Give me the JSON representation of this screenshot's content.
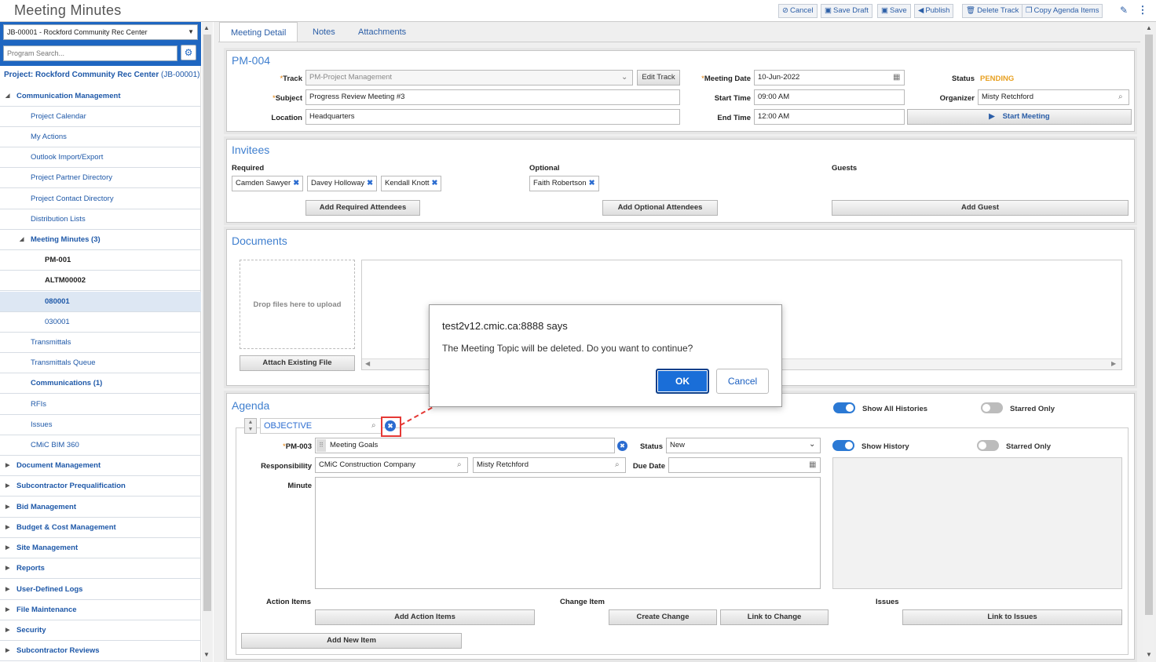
{
  "app": {
    "title": "Meeting Minutes"
  },
  "toolbar": {
    "cancel": "Cancel",
    "save_draft": "Save Draft",
    "save": "Save",
    "publish": "Publish",
    "delete_track": "Delete Track",
    "copy_agenda_items": "Copy Agenda Items"
  },
  "sidebar": {
    "project_select": "JB-00001 - Rockford Community Rec Center",
    "search_placeholder": "Program Search...",
    "project_label": "Project: Rockford Community Rec Center",
    "project_code": "(JB-00001)",
    "items": [
      {
        "label": "Communication Management"
      },
      {
        "label": "Project Calendar"
      },
      {
        "label": "My Actions"
      },
      {
        "label": "Outlook Import/Export"
      },
      {
        "label": "Project Partner Directory"
      },
      {
        "label": "Project Contact Directory"
      },
      {
        "label": "Distribution Lists"
      },
      {
        "label": "Meeting Minutes (3)"
      },
      {
        "label": "PM-001"
      },
      {
        "label": "ALTM00002"
      },
      {
        "label": "080001"
      },
      {
        "label": "030001"
      },
      {
        "label": "Transmittals"
      },
      {
        "label": "Transmittals Queue"
      },
      {
        "label": "Communications (1)"
      },
      {
        "label": "RFIs"
      },
      {
        "label": "Issues"
      },
      {
        "label": "CMiC BIM 360"
      },
      {
        "label": "Document Management"
      },
      {
        "label": "Subcontractor Prequalification"
      },
      {
        "label": "Bid Management"
      },
      {
        "label": "Budget & Cost Management"
      },
      {
        "label": "Site Management"
      },
      {
        "label": "Reports"
      },
      {
        "label": "User-Defined Logs"
      },
      {
        "label": "File Maintenance"
      },
      {
        "label": "Security"
      },
      {
        "label": "Subcontractor Reviews"
      }
    ]
  },
  "tabs": [
    "Meeting Detail",
    "Notes",
    "Attachments"
  ],
  "meeting": {
    "id": "PM-004",
    "track_label": "Track",
    "track_value": "PM-Project Management",
    "edit_track": "Edit Track",
    "subject_label": "Subject",
    "subject_value": "Progress Review Meeting #3",
    "location_label": "Location",
    "location_value": "Headquarters",
    "date_label": "Meeting Date",
    "date_value": "10-Jun-2022",
    "start_label": "Start Time",
    "start_value": "09:00 AM",
    "end_label": "End Time",
    "end_value": "12:00 AM",
    "status_label": "Status",
    "status_value": "PENDING",
    "organizer_label": "Organizer",
    "organizer_value": "Misty Retchford",
    "start_meeting": "Start Meeting"
  },
  "invitees": {
    "title": "Invitees",
    "required_label": "Required",
    "optional_label": "Optional",
    "guests_label": "Guests",
    "required": [
      "Camden Sawyer",
      "Davey Holloway",
      "Kendall Knott"
    ],
    "optional": [
      "Faith Robertson"
    ],
    "add_required": "Add Required Attendees",
    "add_optional": "Add Optional Attendees",
    "add_guest": "Add Guest"
  },
  "documents": {
    "title": "Documents",
    "drop_text": "Drop files here to upload",
    "attach_existing": "Attach Existing File"
  },
  "agenda": {
    "title": "Agenda",
    "show_all_histories": "Show All Histories",
    "starred_only": "Starred Only",
    "topic": "OBJECTIVE",
    "item_id": "PM-003",
    "item_value": "Meeting Goals",
    "status_label": "Status",
    "status_value": "New",
    "show_history": "Show History",
    "starred_only_2": "Starred Only",
    "responsibility_label": "Responsibility",
    "responsibility_company": "CMiC Construction Company",
    "responsibility_person": "Misty Retchford",
    "due_date_label": "Due Date",
    "minute_label": "Minute",
    "action_items_label": "Action Items",
    "change_item_label": "Change Item",
    "issues_label": "Issues",
    "add_action_items": "Add Action Items",
    "create_change": "Create Change",
    "link_to_change": "Link to Change",
    "link_to_issues": "Link to Issues",
    "add_new_item": "Add New Item"
  },
  "dialog": {
    "title": "test2v12.cmic.ca:8888 says",
    "message": "The Meeting Topic will be deleted. Do you want to continue?",
    "ok": "OK",
    "cancel": "Cancel"
  },
  "colors": {
    "accent": "#1e66c1",
    "status_pending": "#e8a020",
    "highlight": "#e53935"
  }
}
